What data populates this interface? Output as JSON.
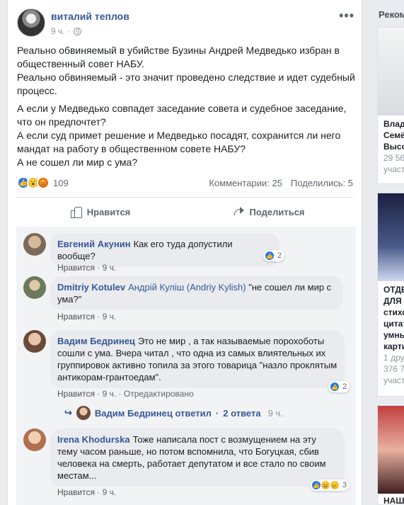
{
  "post": {
    "author": "виталий теплов",
    "time": "9 ч.",
    "more": "•••",
    "paragraphs": [
      "Реально обвиняемый в убийстве Бузины Андрей Медведько избран в общественный совет НАБУ.\nРеально обвиняемый - это значит проведено следствие и идет судебный процесс.",
      "А если у Медведько совпадет заседание совета и судебное заседание, что он предпочтет?\nА если суд примет решение и Медведько посадят, сохранится ли него мандат на работу в общественном совете НАБУ?\nА не сошел ли мир с ума?"
    ],
    "reactions_count": "109",
    "comments_count": "Комментарии: 25",
    "shares_count": "Поделились: 5",
    "like_label": "Нравится",
    "share_label": "Поделиться"
  },
  "comments": [
    {
      "name": "Евгений Акунин",
      "text": "Как его туда допустили вообще?",
      "like": "Нравится",
      "time": "9 ч.",
      "reacts": "2"
    },
    {
      "name": "Dmitriy Kotulev",
      "tag": "Андрій Куліш (Andriy Kylish)",
      "text": "\"не сошел ли мир с ума?\"",
      "like": "Нравится",
      "time": "9 ч."
    },
    {
      "name": "Вадим Бедринец",
      "text": "Это не мир , а так называемые порохоботы сошли с ума. Вчера читал , что одна из самых влиятельных их группировок активно топила за этого товарица \"назло проклятым антикорам-грантоедам\".",
      "like": "Нравится",
      "time": "9 ч.",
      "edited": "Отредактировано",
      "reacts": "2",
      "reply": {
        "label": "Вадим Бедринец ответил",
        "count": "2 ответа",
        "time": "9 ч."
      }
    },
    {
      "name": "Irena Khodurska",
      "text": "Тоже написала пост с возмущением на эту тему часом раньше, но потом вспомнила, что Богуцкая, сбив человека на смерть, работает депутатом и все стало по своим местам...",
      "like": "Нравится",
      "time": "9 ч.",
      "reacts": "3"
    }
  ],
  "sidebar": {
    "title": "Реком",
    "cards": [
      {
        "lines": [
          "Влад",
          "Семё",
          "Высо"
        ],
        "sub": [
          "29 56",
          "участ"
        ]
      },
      {
        "lines": [
          "ОТДЕ",
          "ДЛЯ",
          "стихо",
          "цитат",
          "умны",
          "карти"
        ],
        "sub": [
          "1 дру",
          "376 7",
          "участ"
        ]
      },
      {
        "lines": [
          "НАШ"
        ],
        "sub": []
      }
    ]
  },
  "colors": {
    "link": "#385898",
    "like_blue": "#2078f4",
    "muted": "#606770"
  }
}
